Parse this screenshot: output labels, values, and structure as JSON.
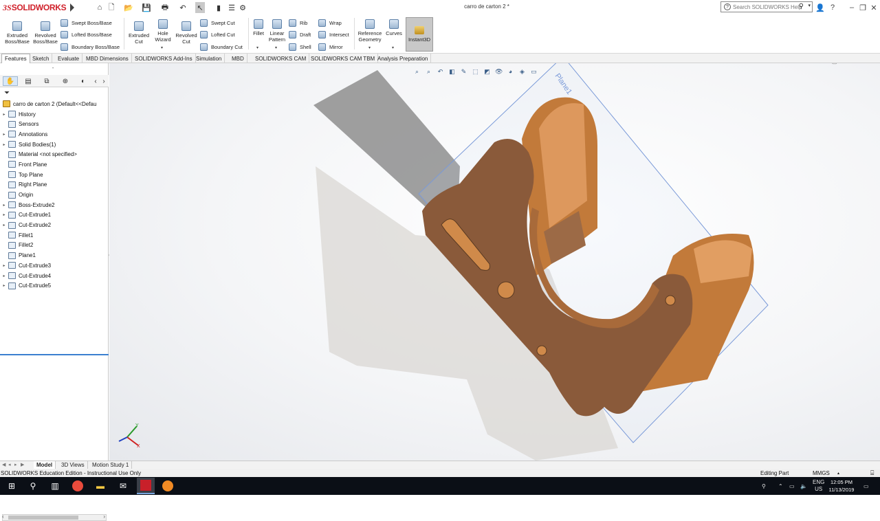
{
  "app": {
    "brand_ds": "3S",
    "brand_name": "SOLIDWORKS",
    "document_title": "carro de carton 2 *",
    "search_placeholder": "Search SOLIDWORKS Help"
  },
  "ribbon": {
    "big_buttons": [
      {
        "id": "extruded-boss",
        "line1": "Extruded",
        "line2": "Boss/Base"
      },
      {
        "id": "revolved-boss",
        "line1": "Revolved",
        "line2": "Boss/Base"
      },
      {
        "id": "extruded-cut",
        "line1": "Extruded",
        "line2": "Cut"
      },
      {
        "id": "hole-wizard",
        "line1": "Hole",
        "line2": "Wizard"
      },
      {
        "id": "revolved-cut",
        "line1": "Revolved",
        "line2": "Cut"
      },
      {
        "id": "fillet",
        "line1": "Fillet",
        "line2": ""
      },
      {
        "id": "linear-pattern",
        "line1": "Linear",
        "line2": "Pattern"
      },
      {
        "id": "reference-geometry",
        "line1": "Reference",
        "line2": "Geometry"
      },
      {
        "id": "curves",
        "line1": "Curves",
        "line2": ""
      }
    ],
    "small_buttons": {
      "swept_boss": "Swept Boss/Base",
      "lofted_boss": "Lofted Boss/Base",
      "boundary_boss": "Boundary Boss/Base",
      "swept_cut": "Swept Cut",
      "lofted_cut": "Lofted Cut",
      "boundary_cut": "Boundary Cut",
      "rib": "Rib",
      "draft": "Draft",
      "shell": "Shell",
      "wrap": "Wrap",
      "intersect": "Intersect",
      "mirror": "Mirror"
    },
    "instant3d": "Instant3D"
  },
  "command_tabs": [
    "Features",
    "Sketch",
    "Evaluate",
    "MBD Dimensions",
    "SOLIDWORKS Add-Ins",
    "Simulation",
    "MBD",
    "SOLIDWORKS CAM",
    "SOLIDWORKS CAM TBM",
    "Analysis Preparation"
  ],
  "tree": {
    "root": "carro de carton 2  (Default<<Defau",
    "items": [
      {
        "label": "History",
        "expandable": true
      },
      {
        "label": "Sensors",
        "expandable": false
      },
      {
        "label": "Annotations",
        "expandable": true
      },
      {
        "label": "Solid Bodies(1)",
        "expandable": true
      },
      {
        "label": "Material <not specified>",
        "expandable": false
      },
      {
        "label": "Front Plane",
        "expandable": false
      },
      {
        "label": "Top Plane",
        "expandable": false
      },
      {
        "label": "Right Plane",
        "expandable": false
      },
      {
        "label": "Origin",
        "expandable": false
      },
      {
        "label": "Boss-Extrude2",
        "expandable": true
      },
      {
        "label": "Cut-Extrude1",
        "expandable": true
      },
      {
        "label": "Cut-Extrude2",
        "expandable": true
      },
      {
        "label": "Fillet1",
        "expandable": false
      },
      {
        "label": "Fillet2",
        "expandable": false
      },
      {
        "label": "Plane1",
        "expandable": false
      },
      {
        "label": "Cut-Extrude3",
        "expandable": true
      },
      {
        "label": "Cut-Extrude4",
        "expandable": true
      },
      {
        "label": "Cut-Extrude5",
        "expandable": true
      }
    ]
  },
  "viewport": {
    "plane_label": "Plane1",
    "triad": {
      "x": "X",
      "y": "Y",
      "z": "Z"
    },
    "part_color": "#8a5a3a",
    "part_highlight": "#d08a4a",
    "plane_color": "#7a9ad8"
  },
  "bottom_tabs": [
    "Model",
    "3D Views",
    "Motion Study 1"
  ],
  "status": {
    "left": "SOLIDWORKS Education Edition - Instructional Use Only",
    "mode": "Editing Part",
    "units": "MMGS"
  },
  "taskbar": {
    "lang": "ENG",
    "region": "US",
    "time": "12:05 PM",
    "date": "11/13/2019"
  }
}
